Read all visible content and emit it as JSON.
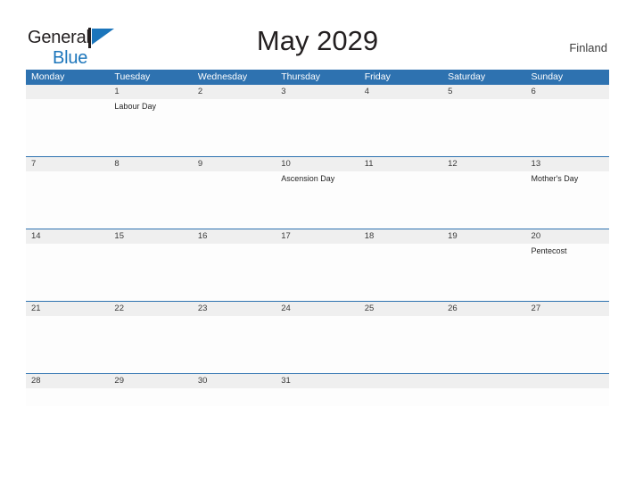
{
  "brand": {
    "name_part1": "General",
    "name_part2": "Blue",
    "flag_icon": "blue-triangle-flag"
  },
  "header": {
    "title": "May 2029",
    "country": "Finland"
  },
  "colors": {
    "header_blue": "#2e72b0",
    "brand_blue": "#1b75bb",
    "date_band_gray": "#efefef",
    "text_dark": "#231f20"
  },
  "calendar": {
    "weekdays": [
      "Monday",
      "Tuesday",
      "Wednesday",
      "Thursday",
      "Friday",
      "Saturday",
      "Sunday"
    ],
    "weeks": [
      {
        "days": [
          {
            "date": "",
            "event": ""
          },
          {
            "date": "1",
            "event": "Labour Day"
          },
          {
            "date": "2",
            "event": ""
          },
          {
            "date": "3",
            "event": ""
          },
          {
            "date": "4",
            "event": ""
          },
          {
            "date": "5",
            "event": ""
          },
          {
            "date": "6",
            "event": ""
          }
        ]
      },
      {
        "days": [
          {
            "date": "7",
            "event": ""
          },
          {
            "date": "8",
            "event": ""
          },
          {
            "date": "9",
            "event": ""
          },
          {
            "date": "10",
            "event": "Ascension Day"
          },
          {
            "date": "11",
            "event": ""
          },
          {
            "date": "12",
            "event": ""
          },
          {
            "date": "13",
            "event": "Mother's Day"
          }
        ]
      },
      {
        "days": [
          {
            "date": "14",
            "event": ""
          },
          {
            "date": "15",
            "event": ""
          },
          {
            "date": "16",
            "event": ""
          },
          {
            "date": "17",
            "event": ""
          },
          {
            "date": "18",
            "event": ""
          },
          {
            "date": "19",
            "event": ""
          },
          {
            "date": "20",
            "event": "Pentecost"
          }
        ]
      },
      {
        "days": [
          {
            "date": "21",
            "event": ""
          },
          {
            "date": "22",
            "event": ""
          },
          {
            "date": "23",
            "event": ""
          },
          {
            "date": "24",
            "event": ""
          },
          {
            "date": "25",
            "event": ""
          },
          {
            "date": "26",
            "event": ""
          },
          {
            "date": "27",
            "event": ""
          }
        ]
      },
      {
        "days": [
          {
            "date": "28",
            "event": ""
          },
          {
            "date": "29",
            "event": ""
          },
          {
            "date": "30",
            "event": ""
          },
          {
            "date": "31",
            "event": ""
          },
          {
            "date": "",
            "event": ""
          },
          {
            "date": "",
            "event": ""
          },
          {
            "date": "",
            "event": ""
          }
        ]
      }
    ]
  }
}
